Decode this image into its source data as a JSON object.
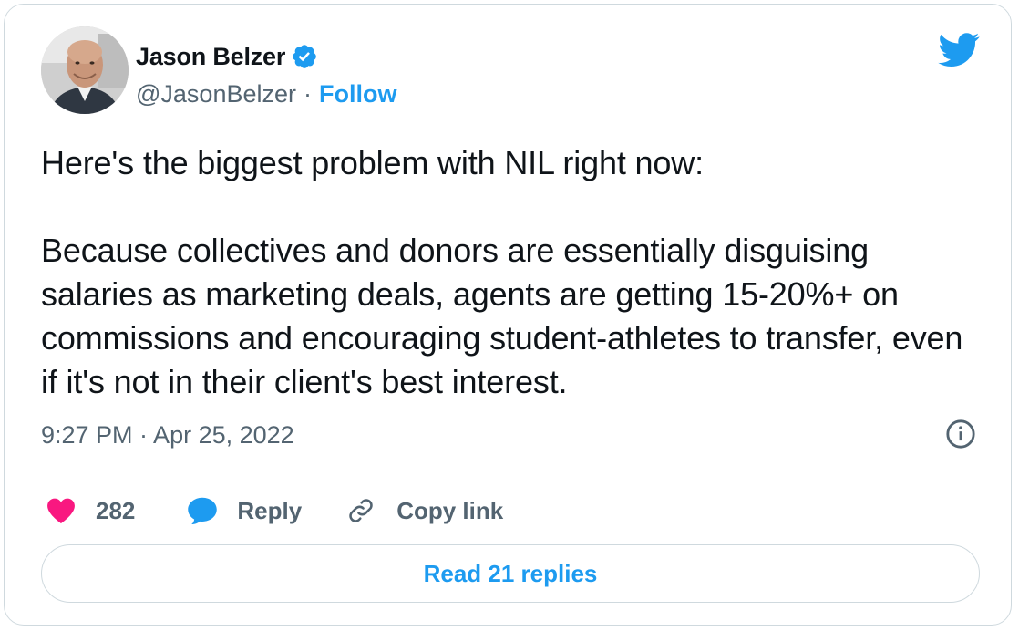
{
  "author": {
    "display_name": "Jason Belzer",
    "handle": "@JasonBelzer",
    "separator": "·",
    "follow_label": "Follow",
    "verified": true
  },
  "tweet": {
    "text": "Here's the biggest problem with NIL right now:\n\nBecause collectives and donors are essentially disguising salaries as marketing deals, agents are getting 15-20%+ on commissions and encouraging student-athletes to transfer, even if it's not in their client's best interest.",
    "timestamp": "9:27 PM · Apr 25, 2022"
  },
  "actions": {
    "like_count": "282",
    "reply_label": "Reply",
    "copy_link_label": "Copy link"
  },
  "read_replies_label": "Read 21 replies",
  "colors": {
    "brand_blue": "#1d9bf0",
    "like_pink": "#f91880",
    "text_primary": "#0f1419",
    "text_secondary": "#536471",
    "border": "#cfd9de"
  },
  "icons": [
    "avatar-photo",
    "verified-badge-icon",
    "twitter-bird-icon",
    "info-icon",
    "heart-icon",
    "reply-bubble-icon",
    "link-icon"
  ]
}
